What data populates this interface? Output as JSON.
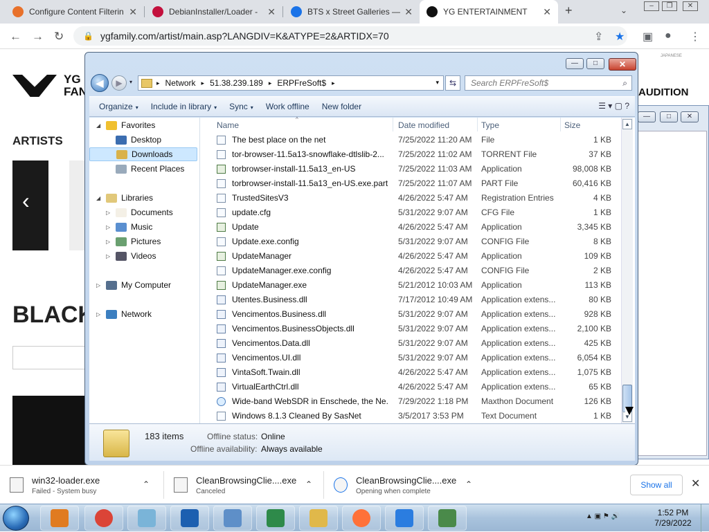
{
  "browser": {
    "tabs": [
      {
        "title": "Configure Content Filterin",
        "close": "✕",
        "color": "#e8712b"
      },
      {
        "title": "DebianInstaller/Loader -",
        "close": "✕",
        "color": "#c3103d"
      },
      {
        "title": "BTS x Street Galleries — (",
        "close": "✕",
        "color": "#1a73e8"
      },
      {
        "title": "YG ENTERTAINMENT",
        "close": "✕",
        "color": "#111111"
      }
    ],
    "new_tab": "+",
    "tab_menu": "⌄",
    "window_controls": [
      "–",
      "❐",
      "✕"
    ],
    "back": "←",
    "forward": "→",
    "reload": "↻",
    "url": "ygfamily.com/artist/main.asp?LANGDIV=K&ATYPE=2&ARTIDX=70",
    "lock": "🔒",
    "share": "⇪",
    "bookmark": "★",
    "sidepanel": "▣",
    "profile": "●",
    "menu": "⋮"
  },
  "site": {
    "logo_text_1": "YG",
    "logo_text_2": "FAN",
    "artists": "ARTISTS",
    "headline": "BLACK",
    "audition": "AUDITION",
    "japanese": "JAPANESE",
    "carousel_prev": "‹"
  },
  "explorer": {
    "title_buttons": {
      "min": "—",
      "max": "□",
      "close": "✕"
    },
    "back": "◀",
    "forward": "▶",
    "dropdown": "▾",
    "breadcrumb": [
      "Network",
      "51.38.239.189",
      "ERPFreSoft$"
    ],
    "breadcrumb_arrow": "▸",
    "refresh": "⇆",
    "search_placeholder": "Search ERPFreSoft$",
    "search_icon": "⌕",
    "commands": [
      "Organize",
      "Include in library",
      "Sync",
      "Work offline",
      "New folder"
    ],
    "cmd_chev": "▾",
    "view_icons": "☰ ▾ ▢ ?",
    "nav": [
      {
        "label": "Favorites",
        "exp": "◢",
        "indent": 0,
        "color": "#f0c030"
      },
      {
        "label": "Desktop",
        "exp": "",
        "indent": 1,
        "color": "#3b6db0"
      },
      {
        "label": "Downloads",
        "exp": "",
        "indent": 1,
        "color": "#d9b24a",
        "selected": true
      },
      {
        "label": "Recent Places",
        "exp": "",
        "indent": 1,
        "color": "#9ab"
      },
      {
        "label": "Libraries",
        "exp": "◢",
        "indent": 0,
        "color": "#e1c87a"
      },
      {
        "label": "Documents",
        "exp": "▷",
        "indent": 1,
        "color": "#f4f0e6"
      },
      {
        "label": "Music",
        "exp": "▷",
        "indent": 1,
        "color": "#5a8fd0"
      },
      {
        "label": "Pictures",
        "exp": "▷",
        "indent": 1,
        "color": "#6aa070"
      },
      {
        "label": "Videos",
        "exp": "▷",
        "indent": 1,
        "color": "#556"
      },
      {
        "label": "My Computer",
        "exp": "▷",
        "indent": 0,
        "color": "#556f8e"
      },
      {
        "label": "Network",
        "exp": "▷",
        "indent": 0,
        "color": "#3c7fc0"
      }
    ],
    "columns": {
      "name": "Name",
      "date": "Date modified",
      "type": "Type",
      "size": "Size",
      "sort": "^"
    },
    "files": [
      {
        "name": "The best place on the net",
        "date": "7/25/2022 11:20 AM",
        "type": "File",
        "size": "1 KB",
        "kind": "doc"
      },
      {
        "name": "tor-browser-11.5a13-snowflake-dtlslib-2...",
        "date": "7/25/2022 11:02 AM",
        "type": "TORRENT File",
        "size": "37 KB",
        "kind": "doc"
      },
      {
        "name": "torbrowser-install-11.5a13_en-US",
        "date": "7/25/2022 11:03 AM",
        "type": "Application",
        "size": "98,008 KB",
        "kind": "app"
      },
      {
        "name": "torbrowser-install-11.5a13_en-US.exe.part",
        "date": "7/25/2022 11:07 AM",
        "type": "PART File",
        "size": "60,416 KB",
        "kind": "doc"
      },
      {
        "name": "TrustedSitesV3",
        "date": "4/26/2022 5:47 AM",
        "type": "Registration Entries",
        "size": "4 KB",
        "kind": "doc"
      },
      {
        "name": "update.cfg",
        "date": "5/31/2022 9:07 AM",
        "type": "CFG File",
        "size": "1 KB",
        "kind": "doc"
      },
      {
        "name": "Update",
        "date": "4/26/2022 5:47 AM",
        "type": "Application",
        "size": "3,345 KB",
        "kind": "app"
      },
      {
        "name": "Update.exe.config",
        "date": "5/31/2022 9:07 AM",
        "type": "CONFIG File",
        "size": "8 KB",
        "kind": "doc"
      },
      {
        "name": "UpdateManager",
        "date": "4/26/2022 5:47 AM",
        "type": "Application",
        "size": "109 KB",
        "kind": "app"
      },
      {
        "name": "UpdateManager.exe.config",
        "date": "4/26/2022 5:47 AM",
        "type": "CONFIG File",
        "size": "2 KB",
        "kind": "doc"
      },
      {
        "name": "UpdateManager.exe",
        "date": "5/21/2012 10:03 AM",
        "type": "Application",
        "size": "113 KB",
        "kind": "app"
      },
      {
        "name": "Utentes.Business.dll",
        "date": "7/17/2012 10:49 AM",
        "type": "Application extens...",
        "size": "80 KB",
        "kind": "dll"
      },
      {
        "name": "Vencimentos.Business.dll",
        "date": "5/31/2022 9:07 AM",
        "type": "Application extens...",
        "size": "928 KB",
        "kind": "dll"
      },
      {
        "name": "Vencimentos.BusinessObjects.dll",
        "date": "5/31/2022 9:07 AM",
        "type": "Application extens...",
        "size": "2,100 KB",
        "kind": "dll"
      },
      {
        "name": "Vencimentos.Data.dll",
        "date": "5/31/2022 9:07 AM",
        "type": "Application extens...",
        "size": "425 KB",
        "kind": "dll"
      },
      {
        "name": "Vencimentos.UI.dll",
        "date": "5/31/2022 9:07 AM",
        "type": "Application extens...",
        "size": "6,054 KB",
        "kind": "dll"
      },
      {
        "name": "VintaSoft.Twain.dll",
        "date": "4/26/2022 5:47 AM",
        "type": "Application extens...",
        "size": "1,075 KB",
        "kind": "dll"
      },
      {
        "name": "VirtualEarthCtrl.dll",
        "date": "4/26/2022 5:47 AM",
        "type": "Application extens...",
        "size": "65 KB",
        "kind": "dll"
      },
      {
        "name": "Wide-band WebSDR in Enschede, the Ne...",
        "date": "7/29/2022 1:18 PM",
        "type": "Maxthon Document",
        "size": "126 KB",
        "kind": "web"
      },
      {
        "name": "Windows 8.1.3 Cleaned By SasNet",
        "date": "3/5/2017 3:53 PM",
        "type": "Text Document",
        "size": "1 KB",
        "kind": "doc"
      }
    ],
    "scroll_up": "▲",
    "scroll_down": "▼",
    "details": {
      "count": "183 items",
      "offline_status_label": "Offline status:",
      "offline_status": "Online",
      "offline_avail_label": "Offline availability:",
      "offline_avail": "Always available"
    }
  },
  "downloads": {
    "items": [
      {
        "name": "win32-loader.exe",
        "status": "Failed - System busy"
      },
      {
        "name": "CleanBrowsingClie....exe",
        "status": "Canceled"
      },
      {
        "name": "CleanBrowsingClie....exe",
        "status": "Opening when complete"
      }
    ],
    "chev": "⌃",
    "show_all": "Show all",
    "close": "✕"
  },
  "taskbar": {
    "apps": [
      {
        "name": "media-player",
        "color": "#e07b20"
      },
      {
        "name": "chrome",
        "color": "#db4437"
      },
      {
        "name": "notepad",
        "color": "#7ab4d8"
      },
      {
        "name": "maxthon",
        "color": "#1c5fb0"
      },
      {
        "name": "control-panel",
        "color": "#5e8fc8"
      },
      {
        "name": "task-app",
        "color": "#2e8a4a"
      },
      {
        "name": "explorer",
        "color": "#e0b84a"
      },
      {
        "name": "firefox",
        "color": "#ff7139"
      },
      {
        "name": "downloader",
        "color": "#2b7de0"
      },
      {
        "name": "other-app",
        "color": "#4a8a4a"
      }
    ],
    "tray": "▲ ▣ ⚑ 🔊",
    "time": "1:52 PM",
    "date": "7/29/2022"
  }
}
